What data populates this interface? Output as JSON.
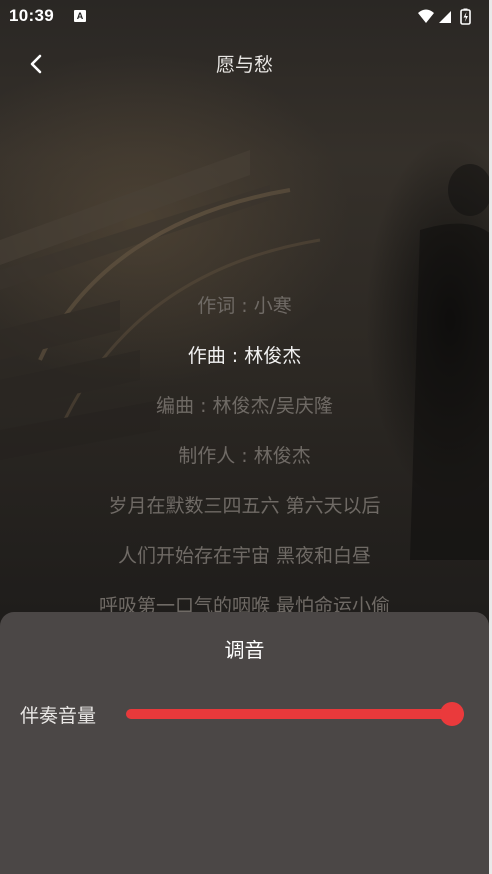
{
  "status_bar": {
    "time": "10:39",
    "notification_icon_letter": "A",
    "icons": [
      "wifi-icon",
      "signal-icon",
      "battery-charging-icon"
    ]
  },
  "toolbar": {
    "back_icon": "chevron-left-icon",
    "title": "愿与愁"
  },
  "lyrics": {
    "lines": [
      "作词 : 小寒",
      "作曲 : 林俊杰",
      "编曲 : 林俊杰/吴庆隆",
      "制作人 : 林俊杰",
      "岁月在默数三四五六 第六天以后",
      "人们开始存在宇宙 黑夜和白昼",
      "呼吸第一口气的咽喉 最怕命运小偷"
    ],
    "active_index": 1
  },
  "tuning_sheet": {
    "title": "调音",
    "accompaniment_label": "伴奏音量",
    "accompaniment_volume": 1.0
  },
  "colors": {
    "accent": "#e8393b",
    "sheet_background": "#4b4746",
    "lyric_inactive": "#6f6a65",
    "lyric_active": "#f2f2f2"
  }
}
